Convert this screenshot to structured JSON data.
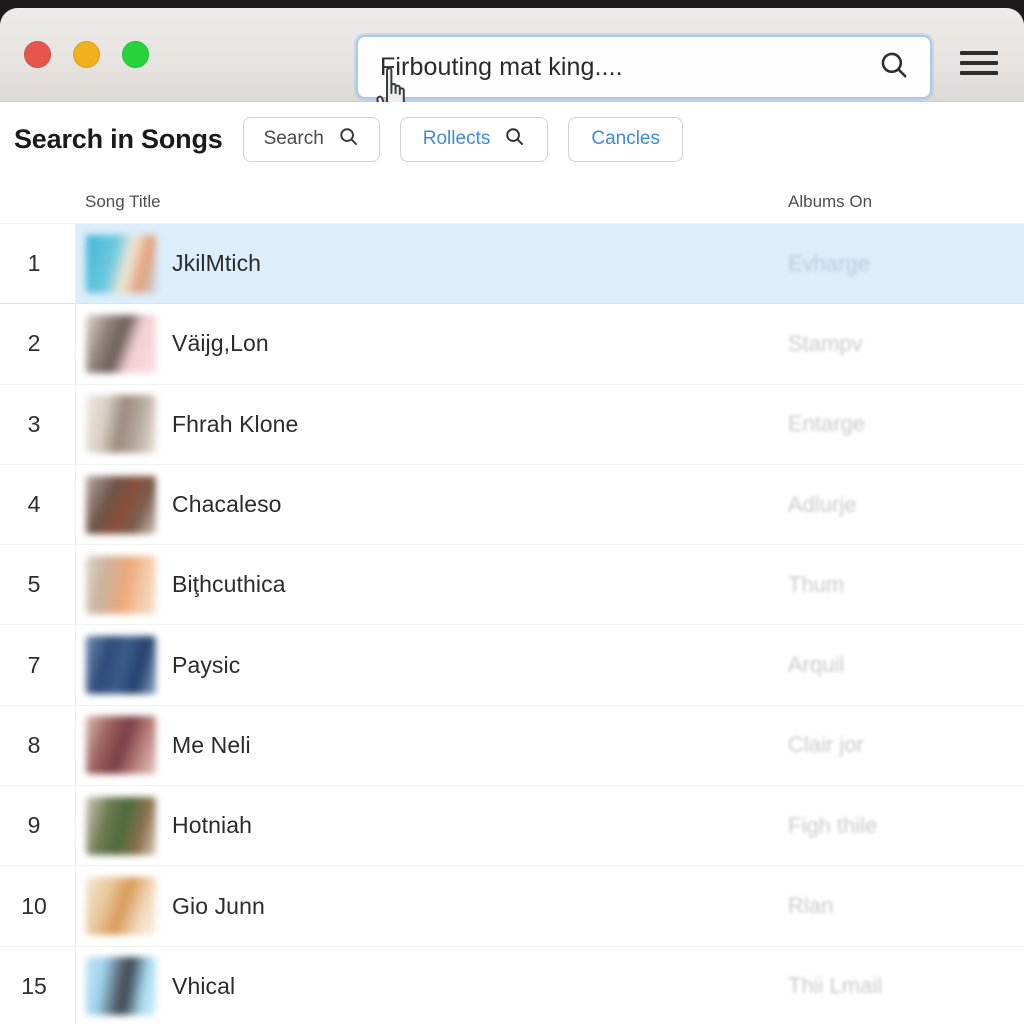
{
  "window": {
    "traffic_lights": [
      {
        "name": "close",
        "color": "#e8554d"
      },
      {
        "name": "minimize",
        "color": "#f2b01e"
      },
      {
        "name": "zoom",
        "color": "#25d33b"
      }
    ]
  },
  "search": {
    "value": "Firbouting mat king....",
    "placeholder": "Search",
    "icon": "search-icon"
  },
  "menu": {
    "icon": "hamburger-icon"
  },
  "cursor": {
    "icon": "pointing-hand-cursor"
  },
  "toolbar": {
    "title": "Search in Songs",
    "buttons": [
      {
        "label": "Search",
        "icon": "search-icon",
        "style": "default"
      },
      {
        "label": "Rollects",
        "icon": "search-icon",
        "style": "link"
      },
      {
        "label": "Cancles",
        "icon": "",
        "style": "link"
      }
    ]
  },
  "table": {
    "columns": {
      "index": "",
      "title": "Song Title",
      "album": "Albums On"
    },
    "selected_index": 0,
    "selection_color": "#dcedfb",
    "rows": [
      {
        "index": "1",
        "title": "JkilMtich",
        "album": "Evharge",
        "thumb": "linear-gradient(105deg,#3fb6d6 0%,#6ec9e0 38%,#f0e7d4 58%,#e2a07a 78%,#c9d7e2 100%)",
        "selected": true
      },
      {
        "index": "2",
        "title": "Väijg,Lon",
        "album": "Stampv",
        "thumb": "linear-gradient(110deg,#ded4cf 0%,#8e7f78 30%,#6d5f59 48%,#f2cfd4 66%,#f7dde2 100%)",
        "selected": false
      },
      {
        "index": "3",
        "title": "Fhrah Klone",
        "album": "Entarge",
        "thumb": "linear-gradient(100deg,#efe9e4 0%,#d8cfc6 28%,#9b8b7d 50%,#b5a79a 72%,#ece5de 100%)",
        "selected": false
      },
      {
        "index": "4",
        "title": "Chacaleso",
        "album": "Adlurje",
        "thumb": "linear-gradient(115deg,#b7aca3 0%,#6d5448 34%,#8a4f3c 54%,#7a5d4c 74%,#cfc5ba 100%)",
        "selected": false
      },
      {
        "index": "5",
        "title": "Biţhcuthica",
        "album": "Thum",
        "thumb": "linear-gradient(100deg,#ded4c8 0%,#c8b49f 26%,#eda87a 56%,#f3c9a6 78%,#f6e2d1 100%)",
        "selected": false
      },
      {
        "index": "7",
        "title": "Paysic",
        "album": "Arquil",
        "thumb": "linear-gradient(105deg,#6e8ab3 0%,#2f4a79 30%,#3c5c8c 52%,#25406d 74%,#8fa6c4 100%)",
        "selected": false
      },
      {
        "index": "8",
        "title": "Me Neli",
        "album": "Clair jor",
        "thumb": "linear-gradient(110deg,#d8b9b4 0%,#9c5f5c 30%,#7a3f46 52%,#b97d79 74%,#e3c9c4 100%)",
        "selected": false
      },
      {
        "index": "9",
        "title": "Hotniah",
        "album": "Figh thile",
        "thumb": "linear-gradient(105deg,#cfc9b8 0%,#6e7a52 30%,#4e6b3d 52%,#8b6f4e 76%,#d6cfbe 100%)",
        "selected": false
      },
      {
        "index": "10",
        "title": "Gio Junn",
        "album": "Rlan",
        "thumb": "linear-gradient(110deg,#f2e7d6 0%,#e8c79a 30%,#d99a58 52%,#f0d9bc 76%,#faf2e6 100%)",
        "selected": false
      },
      {
        "index": "15",
        "title": "Vhical",
        "album": "Thii Lmail",
        "thumb": "linear-gradient(100deg,#bfe4f4 0%,#9fd4ee 24%,#55606b 48%,#3e4a55 58%,#a8daf0 80%,#d4eefa 100%)",
        "selected": false
      }
    ]
  }
}
